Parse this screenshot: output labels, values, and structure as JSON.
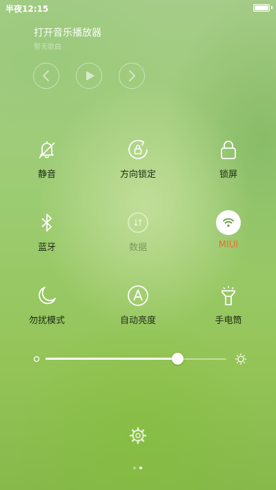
{
  "status_bar": {
    "time": "半夜12:15"
  },
  "music": {
    "title": "打开音乐播放器",
    "artist": "暂无歌曲",
    "controls": {
      "prev_icon": "chevron-left-icon",
      "play_icon": "play-icon",
      "next_icon": "chevron-right-icon"
    }
  },
  "toggles": [
    {
      "label": "静音",
      "icon": "bell-off-icon",
      "state": "off"
    },
    {
      "label": "方向锁定",
      "icon": "rotation-lock-icon",
      "state": "off"
    },
    {
      "label": "锁屏",
      "icon": "lock-icon",
      "state": "off"
    },
    {
      "label": "蓝牙",
      "icon": "bluetooth-icon",
      "state": "off"
    },
    {
      "label": "数据",
      "icon": "mobile-data-icon",
      "state": "disabled"
    },
    {
      "label": "MIUI",
      "icon": "wifi-icon",
      "state": "on"
    },
    {
      "label": "勿扰模式",
      "icon": "moon-icon",
      "state": "off"
    },
    {
      "label": "自动亮度",
      "icon": "auto-brightness-icon",
      "state": "off"
    },
    {
      "label": "手电筒",
      "icon": "flashlight-icon",
      "state": "off"
    }
  ],
  "brightness": {
    "level": 0.73,
    "min_icon": "dim-sun-icon",
    "max_icon": "bright-sun-icon"
  },
  "settings": {
    "icon": "gear-icon"
  },
  "pager": {
    "count": 2,
    "active_index": 1
  },
  "colors": {
    "accent": "#e8702a",
    "icon_white": "#ffffff",
    "text_dark": "#1e2a14"
  }
}
